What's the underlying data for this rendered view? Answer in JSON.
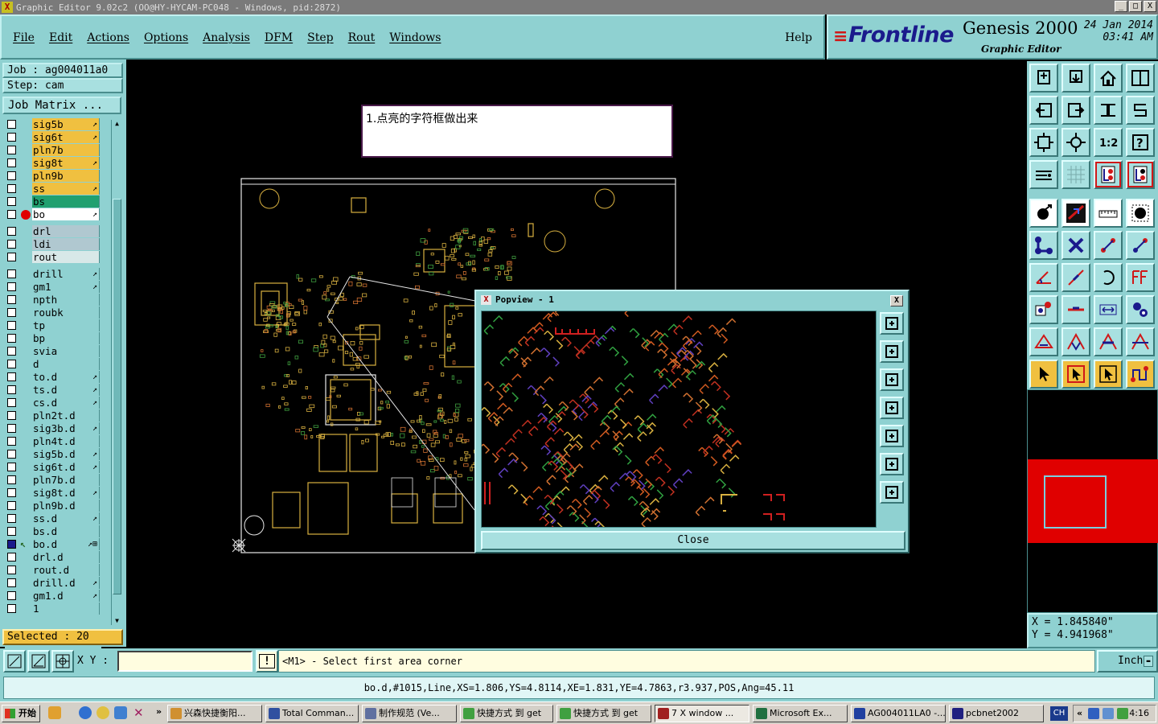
{
  "window": {
    "title": "Graphic Editor 9.02c2 (OO@HY-HYCAM-PC048 - Windows, pid:2872)",
    "min_label": "_",
    "max_label": "□",
    "close_label": "X"
  },
  "menu": {
    "items": [
      "File",
      "Edit",
      "Actions",
      "Options",
      "Analysis",
      "DFM",
      "Step",
      "Rout",
      "Windows"
    ],
    "help": "Help"
  },
  "brand": {
    "logo": "Frontline",
    "product": "Genesis 2000",
    "subtitle": "Graphic Editor",
    "date": "24 Jan 2014",
    "time": "03:41 AM"
  },
  "job": {
    "job_line": "Job : ag004011a0",
    "step_line": "Step: cam",
    "matrix_button": "Job Matrix ..."
  },
  "layers": [
    {
      "name": "sig5b",
      "color": "#f0c040",
      "flag": "↗",
      "checked": false
    },
    {
      "name": "sig6t",
      "color": "#f0c040",
      "flag": "↗",
      "checked": false
    },
    {
      "name": "pln7b",
      "color": "#f0c040",
      "flag": "",
      "checked": false
    },
    {
      "name": "sig8t",
      "color": "#f0c040",
      "flag": "↗",
      "checked": false
    },
    {
      "name": "pln9b",
      "color": "#f0c040",
      "flag": "",
      "checked": false
    },
    {
      "name": "ss",
      "color": "#f0c040",
      "flag": "↗",
      "checked": false
    },
    {
      "name": "bs",
      "color": "#20a070",
      "flag": "",
      "checked": false
    },
    {
      "name": "bo",
      "color": "#ffffff",
      "flag": "↗",
      "checked": false,
      "marker": "dot"
    },
    {
      "name": "drl",
      "color": "#b0c8d0",
      "flag": "",
      "checked": false,
      "gap": true
    },
    {
      "name": "ldi",
      "color": "#b0c8d0",
      "flag": "",
      "checked": false
    },
    {
      "name": "rout",
      "color": "#d8e8e8",
      "flag": "",
      "checked": false
    },
    {
      "name": "drill",
      "color": "#8fd1d1",
      "flag": "↗",
      "checked": false,
      "gap": true
    },
    {
      "name": "gm1",
      "color": "#8fd1d1",
      "flag": "↗",
      "checked": false
    },
    {
      "name": "npth",
      "color": "#8fd1d1",
      "flag": "",
      "checked": false
    },
    {
      "name": "roubk",
      "color": "#8fd1d1",
      "flag": "",
      "checked": false
    },
    {
      "name": "tp",
      "color": "#8fd1d1",
      "flag": "",
      "checked": false
    },
    {
      "name": "bp",
      "color": "#8fd1d1",
      "flag": "",
      "checked": false
    },
    {
      "name": "svia",
      "color": "#8fd1d1",
      "flag": "",
      "checked": false
    },
    {
      "name": "d",
      "color": "#8fd1d1",
      "flag": "",
      "checked": false
    },
    {
      "name": "to.d",
      "color": "#8fd1d1",
      "flag": "↗",
      "checked": false
    },
    {
      "name": "ts.d",
      "color": "#8fd1d1",
      "flag": "↗",
      "checked": false
    },
    {
      "name": "cs.d",
      "color": "#8fd1d1",
      "flag": "↗",
      "checked": false
    },
    {
      "name": "pln2t.d",
      "color": "#8fd1d1",
      "flag": "",
      "checked": false
    },
    {
      "name": "sig3b.d",
      "color": "#8fd1d1",
      "flag": "↗",
      "checked": false
    },
    {
      "name": "pln4t.d",
      "color": "#8fd1d1",
      "flag": "",
      "checked": false
    },
    {
      "name": "sig5b.d",
      "color": "#8fd1d1",
      "flag": "↗",
      "checked": false
    },
    {
      "name": "sig6t.d",
      "color": "#8fd1d1",
      "flag": "↗",
      "checked": false
    },
    {
      "name": "pln7b.d",
      "color": "#8fd1d1",
      "flag": "",
      "checked": false
    },
    {
      "name": "sig8t.d",
      "color": "#8fd1d1",
      "flag": "↗",
      "checked": false
    },
    {
      "name": "pln9b.d",
      "color": "#8fd1d1",
      "flag": "",
      "checked": false
    },
    {
      "name": "ss.d",
      "color": "#8fd1d1",
      "flag": "↗",
      "checked": false
    },
    {
      "name": "bs.d",
      "color": "#8fd1d1",
      "flag": "",
      "checked": false
    },
    {
      "name": "bo.d",
      "color": "#8fd1d1",
      "flag": "↗⊞",
      "checked": true,
      "marker": "arrow"
    },
    {
      "name": "drl.d",
      "color": "#8fd1d1",
      "flag": "",
      "checked": false
    },
    {
      "name": "rout.d",
      "color": "#8fd1d1",
      "flag": "",
      "checked": false
    },
    {
      "name": "drill.d",
      "color": "#8fd1d1",
      "flag": "↗",
      "checked": false
    },
    {
      "name": "gm1.d",
      "color": "#8fd1d1",
      "flag": "↗",
      "checked": false
    },
    {
      "name": "1",
      "color": "#8fd1d1",
      "flag": "",
      "checked": false
    }
  ],
  "selected_text": "Selected : 20",
  "note_text": "1.点亮的字符框做出来",
  "popview": {
    "title": "Popview - 1",
    "close_label": "Close",
    "x_label": "X"
  },
  "coords": {
    "x": "X = 1.845840\"",
    "y": "Y = 4.941968\""
  },
  "bottom": {
    "xy_label": "X Y :",
    "xy_value": "",
    "prompt": "<M1> - Select first area corner",
    "unit": "Inch",
    "warn_label": "!"
  },
  "status_line": "bo.d,#1015,Line,XS=1.806,YS=4.8114,XE=1.831,YE=4.7863,r3.937,POS,Ang=45.11",
  "taskbar": {
    "start": "开始",
    "more": "»",
    "tasks": [
      {
        "label": "兴森快捷衡阳...",
        "icon_color": "#d09030"
      },
      {
        "label": "Total Comman...",
        "icon_color": "#3050a0"
      },
      {
        "label": "制作规范 (Ve...",
        "icon_color": "#6070a0"
      },
      {
        "label": "快捷方式 到 get",
        "icon_color": "#40a040"
      },
      {
        "label": "快捷方式 到 get",
        "icon_color": "#40a040"
      },
      {
        "label": "7 X window ...",
        "icon_color": "#a02020",
        "active": true
      },
      {
        "label": "Microsoft Ex...",
        "icon_color": "#207040"
      },
      {
        "label": "AG004011LA0 -...",
        "icon_color": "#2040a0"
      },
      {
        "label": "pcbnet2002",
        "icon_color": "#202080"
      }
    ],
    "lang": "CH",
    "tray_more": "«",
    "clock": "4:16"
  }
}
